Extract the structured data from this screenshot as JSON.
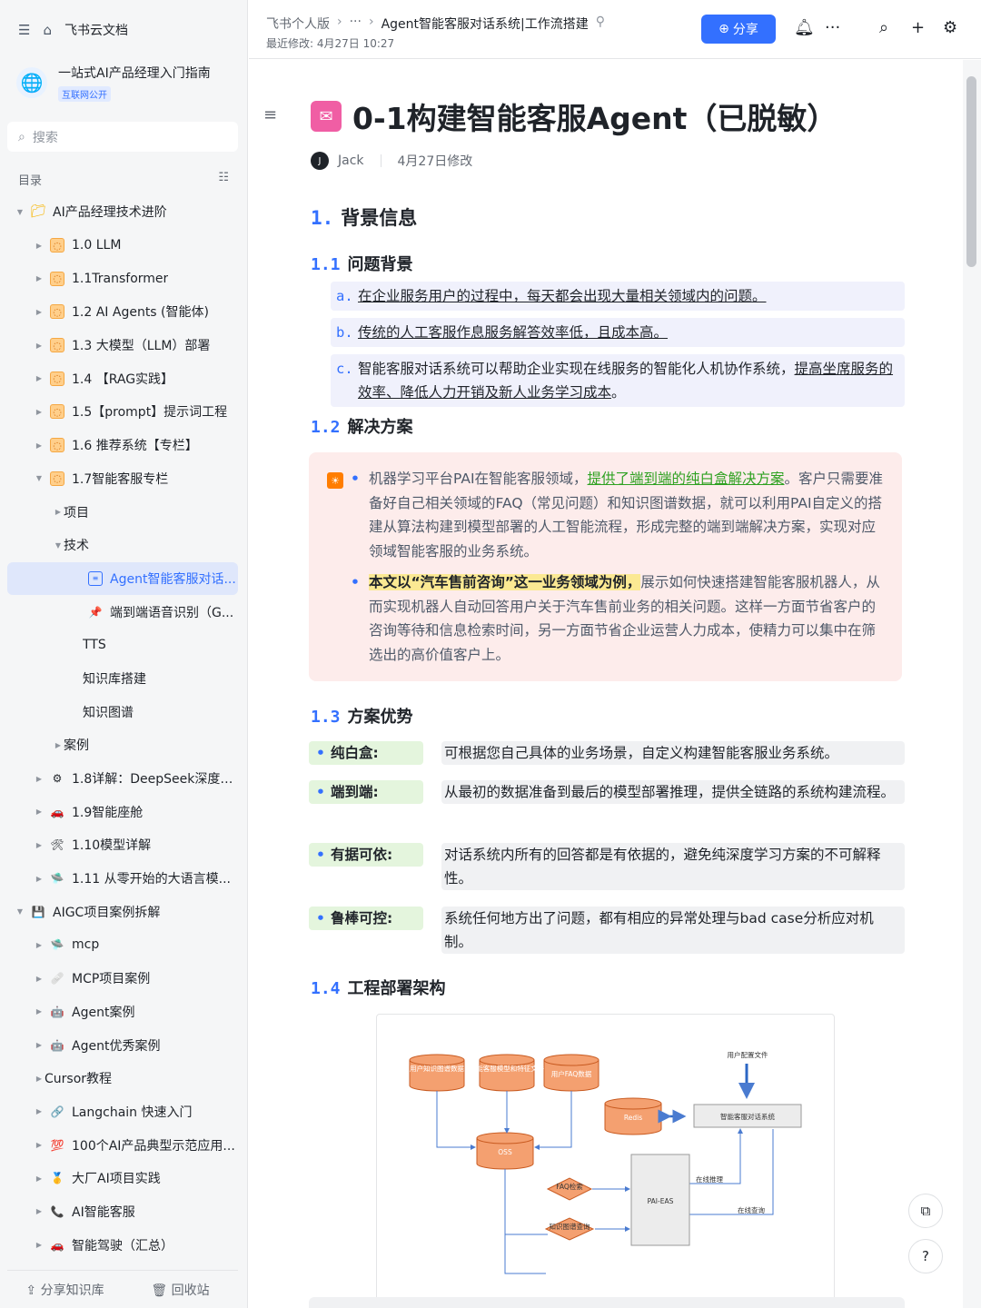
{
  "sidebar": {
    "top_title": "飞书云文档",
    "space": {
      "name": "一站式AI产品经理入门指南",
      "tag": "互联网公开"
    },
    "search_placeholder": "搜索",
    "toc_label": "目录",
    "items": [
      {
        "label": "AI产品经理技术进阶",
        "icon": "folder-icon",
        "indent": 0,
        "arrow": "down"
      },
      {
        "label": "1.0 LLM",
        "icon": "orange-icon",
        "indent": 1,
        "arrow": "right"
      },
      {
        "label": "1.1Transformer",
        "icon": "orange-icon",
        "indent": 1,
        "arrow": "right"
      },
      {
        "label": "1.2 AI Agents (智能体)",
        "icon": "orange-icon",
        "indent": 1,
        "arrow": "right"
      },
      {
        "label": "1.3 大模型（LLM）部署",
        "icon": "orange-icon",
        "indent": 1,
        "arrow": "right"
      },
      {
        "label": "1.4 【RAG实践】",
        "icon": "orange-icon",
        "indent": 1,
        "arrow": "right"
      },
      {
        "label": "1.5【prompt】提示词工程",
        "icon": "orange-icon",
        "indent": 1,
        "arrow": "right"
      },
      {
        "label": "1.6 推荐系统【专栏】",
        "icon": "orange-icon",
        "indent": 1,
        "arrow": "right"
      },
      {
        "label": "1.7智能客服专栏",
        "icon": "orange-icon",
        "indent": 1,
        "arrow": "down"
      },
      {
        "label": "项目",
        "icon": "doc-icon",
        "indent": 2,
        "arrow": "right"
      },
      {
        "label": "技术",
        "icon": "doc-icon",
        "indent": 2,
        "arrow": "down"
      },
      {
        "label": "Agent智能客服对话...",
        "icon": "doc-icon",
        "indent": 3,
        "arrow": "",
        "active": true
      },
      {
        "label": "端到端语音识别（G...",
        "icon": "pin-icon",
        "indent": 3,
        "arrow": ""
      },
      {
        "label": "TTS",
        "icon": "doc-icon",
        "indent": 3,
        "arrow": ""
      },
      {
        "label": "知识库搭建",
        "icon": "doc-icon",
        "indent": 3,
        "arrow": ""
      },
      {
        "label": "知识图谱",
        "icon": "doc-icon",
        "indent": 3,
        "arrow": ""
      },
      {
        "label": "案例",
        "icon": "doc-icon",
        "indent": 2,
        "arrow": "right"
      },
      {
        "label": "1.8详解：DeepSeek深度推...",
        "icon": "gear-icon",
        "indent": 1,
        "arrow": "right"
      },
      {
        "label": "1.9智能座舱",
        "icon": "car-icon",
        "indent": 1,
        "arrow": "right"
      },
      {
        "label": "1.10模型详解",
        "icon": "tools-icon",
        "indent": 1,
        "arrow": "right"
      },
      {
        "label": "1.11 从零开始的大语言模...",
        "icon": "stack-icon",
        "indent": 1,
        "arrow": "right"
      },
      {
        "label": "AIGC项目案例拆解",
        "icon": "save-icon",
        "indent": 0,
        "arrow": "down"
      },
      {
        "label": "mcp",
        "icon": "stack-icon",
        "indent": 1,
        "arrow": "right"
      },
      {
        "label": "MCP项目案例",
        "icon": "bandage-icon",
        "indent": 1,
        "arrow": "right"
      },
      {
        "label": "Agent案例",
        "icon": "robot-icon",
        "indent": 1,
        "arrow": "right"
      },
      {
        "label": "Agent优秀案例",
        "icon": "robot-icon",
        "indent": 1,
        "arrow": "right"
      },
      {
        "label": "Cursor教程",
        "icon": "doc-icon",
        "indent": 1,
        "arrow": "right"
      },
      {
        "label": "Langchain 快速入门",
        "icon": "chain-icon",
        "indent": 1,
        "arrow": "right"
      },
      {
        "label": "100个AI产品典型示范应用...",
        "icon": "hundred-icon",
        "indent": 1,
        "arrow": "right"
      },
      {
        "label": "大厂AI项目实践",
        "icon": "medal-icon",
        "indent": 1,
        "arrow": "right"
      },
      {
        "label": "AI智能客服",
        "icon": "phone-icon",
        "indent": 1,
        "arrow": "right"
      },
      {
        "label": "智能驾驶（汇总）",
        "icon": "car-icon",
        "indent": 1,
        "arrow": "right"
      }
    ],
    "bottom": {
      "share": "分享知识库",
      "trash": "回收站"
    }
  },
  "header": {
    "crumb_1": "飞书个人版",
    "crumb_2": "···",
    "crumb_3": "Agent智能客服对话系统|工作流搭建",
    "modified": "最近修改: 4月27日 10:27",
    "share_label": "分享"
  },
  "doc": {
    "title": "0-1构建智能客服Agent（已脱敏）",
    "author": "Jack",
    "modified": "4月27日修改",
    "h1": {
      "num": "1.",
      "text": "背景信息"
    },
    "h2_1": {
      "num": "1.1",
      "text": "问题背景"
    },
    "bg_items": [
      {
        "mark": "a.",
        "text": "在企业服务用户的过程中，每天都会出现大量相关领域内的问题。"
      },
      {
        "mark": "b.",
        "text": "传统的人工客服作息服务解答效率低，且成本高。"
      },
      {
        "mark": "c.",
        "text_a": "智能客服对话系统可以帮助企业实现在线服务的智能化人机协作系统，",
        "text_b": "提高坐席服务的效率、降低人力开销及新人业务学习成本",
        "text_c": "。"
      }
    ],
    "h2_2": {
      "num": "1.2",
      "text": "解决方案"
    },
    "sol_1": {
      "a": "机器学习平台PAI在智能客服领域，",
      "link": "提供了端到端的纯白盒解决方案",
      "b": "。客户只需要准备好自己相关领域的FAQ（常见问题）和知识图谱数据，就可以利用PAI自定义的搭建从算法构建到模型部署的人工智能流程，形成完整的端到端解决方案，实现对应领域智能客服的业务系统。"
    },
    "sol_2": {
      "hl": "本文以“汽车售前咨询”这一业务领域为例，",
      "b": "展示如何快速搭建智能客服机器人，从而实现机器人自动回答用户关于汽车售前业务的相关问题。这样一方面节省客户的咨询等待和信息检索时间，另一方面节省企业运营人力成本，使精力可以集中在筛选出的高价值客户上。"
    },
    "h2_3": {
      "num": "1.3",
      "text": "方案优势"
    },
    "advantages": [
      {
        "key": "纯白盒:",
        "val": "可根据您自己具体的业务场景，自定义构建智能客服业务系统。"
      },
      {
        "key": "端到端:",
        "val": "从最初的数据准备到最后的模型部署推理，提供全链路的系统构建流程。"
      },
      {
        "key": "有据可依:",
        "val": "对话系统内所有的回答都是有依据的，避免纯深度学习方案的不可解释性。"
      },
      {
        "key": "鲁棒可控:",
        "val": "系统任何地方出了问题，都有相应的异常处理与bad case分析应对机制。"
      }
    ],
    "h2_4": {
      "num": "1.4",
      "text": "工程部署架构"
    },
    "diagram": {
      "db1": "用户知识图谱数据",
      "db2": "智能客服模型和特征文件",
      "db3": "用户FAQ数据",
      "redis": "Redis",
      "oss": "OSS",
      "user_config": "用户配置文件",
      "system": "智能客服对话系统",
      "faq": "FAQ检索",
      "kg": "知识图谱查询",
      "pai": "PAI-EAS",
      "online_infer": "在线推理",
      "online_query": "在线查询"
    }
  }
}
